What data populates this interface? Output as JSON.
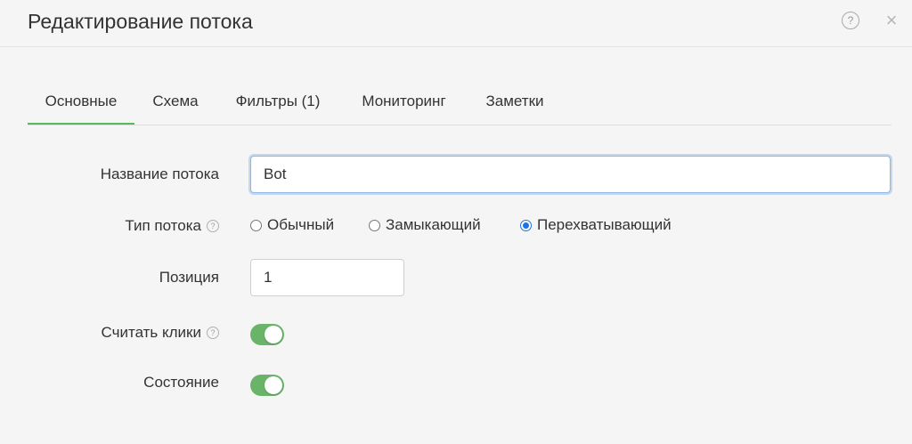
{
  "dialog": {
    "title": "Редактирование потока",
    "help_icon": "question-circle-icon",
    "help_glyph": "?",
    "close_icon": "close-icon",
    "close_glyph": "×"
  },
  "tabs": [
    {
      "label": "Основные",
      "active": true
    },
    {
      "label": "Схема",
      "active": false
    },
    {
      "label": "Фильтры (1)",
      "active": false
    },
    {
      "label": "Мониторинг",
      "active": false
    },
    {
      "label": "Заметки",
      "active": false
    }
  ],
  "form": {
    "name": {
      "label": "Название потока",
      "value": "Bot"
    },
    "type": {
      "label": "Тип потока",
      "help_glyph": "?",
      "options": [
        {
          "label": "Обычный",
          "checked": false
        },
        {
          "label": "Замыкающий",
          "checked": false
        },
        {
          "label": "Перехватывающий",
          "checked": true
        }
      ]
    },
    "position": {
      "label": "Позиция",
      "value": "1"
    },
    "count_clicks": {
      "label": "Считать клики",
      "help_glyph": "?",
      "enabled": true
    },
    "state": {
      "label": "Состояние",
      "enabled": true
    }
  },
  "colors": {
    "accent_green": "#5cb85c",
    "toggle_on": "#6ab46a",
    "radio_blue": "#1a73e8",
    "focus_blue": "#8fb8e6"
  }
}
